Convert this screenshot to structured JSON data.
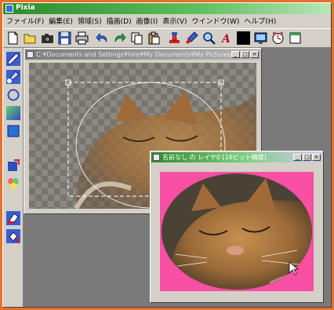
{
  "app": {
    "title": "Pixia"
  },
  "menu": [
    "ファイル(F)",
    "編集(E)",
    "領域(S)",
    "描画(D)",
    "画像(I)",
    "表示(V)",
    "ウインドウ(W)",
    "ヘルプ(H)"
  ],
  "toolbar": {
    "icons": [
      "new-file-icon",
      "open-folder-icon",
      "camera-icon",
      "save-icon",
      "print-icon",
      "undo-icon",
      "redo-icon",
      "copy-icon",
      "paste-icon",
      "stamp-icon",
      "brush-icon",
      "zoom-icon",
      "text-icon",
      "black-swatch-icon",
      "screen-icon",
      "clock-icon",
      "window-icon"
    ]
  },
  "tools": [
    "pen-tool-icon",
    "brush-tool-icon",
    "lasso-tool-icon",
    "gradient-tool-icon",
    "rectangle-tool-icon",
    "move-tool-icon",
    "palette-tool-icon",
    "eraser-tool-icon",
    "fill-tool-icon"
  ],
  "windows": {
    "main_doc": {
      "title": "C:¥Documents and Settings¥hiro¥My Documents¥My Pictures...",
      "buttons": [
        "_",
        "□",
        "×"
      ]
    },
    "layer_doc": {
      "title": "名前なし の レイヤ0 [16ビット精度]",
      "buttons": [
        "_",
        "□",
        "×"
      ]
    }
  },
  "colors": {
    "desktop": "#e7702a",
    "workspace": "#7a7a7a",
    "layer_background": "#f94fa4"
  }
}
